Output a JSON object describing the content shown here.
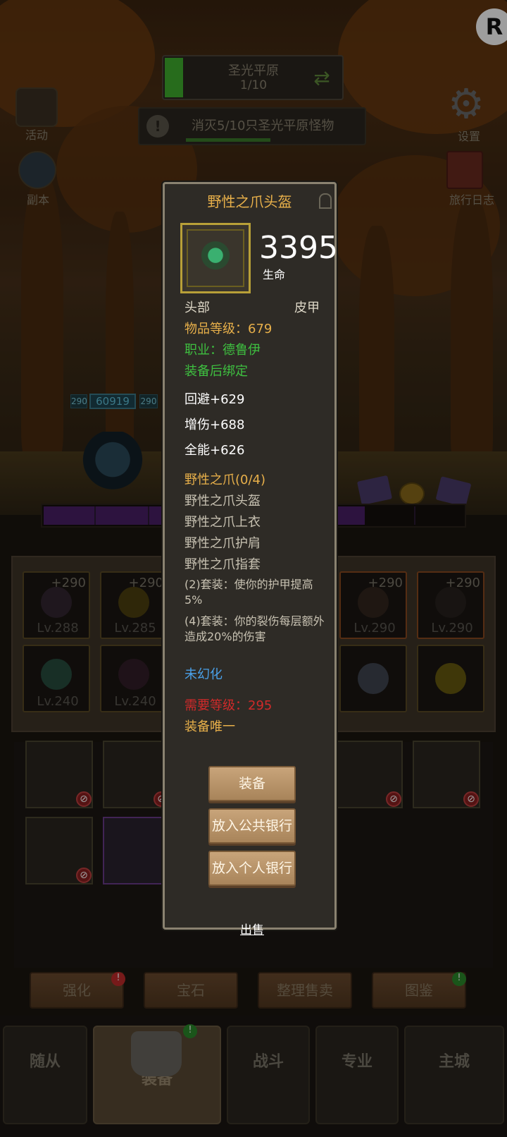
{
  "hud": {
    "stage_name": "圣光平原",
    "stage_progress": "1/10",
    "quest_text": "消灭5/10只圣光平原怪物",
    "quest_icon": "!",
    "side_left": [
      {
        "label": "活动",
        "icon": "scroll-icon"
      },
      {
        "label": "副本",
        "icon": "portal-icon"
      }
    ],
    "side_right": [
      {
        "label": "设置",
        "icon": "gear-icon"
      },
      {
        "label": "旅行日志",
        "icon": "book-icon"
      }
    ],
    "logo": "R"
  },
  "battle": {
    "level_chip_1": "290",
    "hp_value": "60919",
    "level_chip_2": "290",
    "xp_fraction": 0.76
  },
  "equipment": [
    {
      "plus": "+290",
      "level": "Lv.288"
    },
    {
      "plus": "+290",
      "level": "Lv.285"
    },
    {
      "plus": "+290",
      "level": "Lv.290"
    },
    {
      "plus": "+290",
      "level": "Lv.290"
    },
    {
      "plus": "",
      "level": "Lv.240"
    },
    {
      "plus": "",
      "level": "Lv.240"
    },
    {
      "plus": "",
      "level": ""
    },
    {
      "plus": "",
      "level": ""
    }
  ],
  "bottom_buttons": {
    "enhance": "强化",
    "gem": "宝石",
    "sort_sell": "整理售卖",
    "codex": "图鉴",
    "badge_alert": "!",
    "badge_ok": "!"
  },
  "nav": {
    "companion": "随从",
    "equipment": "装备",
    "battle": "战斗",
    "profession": "专业",
    "city": "主城",
    "badge": "!"
  },
  "tooltip": {
    "title": "野性之爪头盔",
    "stat_value": "3395",
    "stat_label": "生命",
    "slot": "头部",
    "armor_type": "皮甲",
    "item_level": "物品等级：679",
    "class_req": "职业：德鲁伊",
    "bind": "装备后绑定",
    "stats": [
      "回避+629",
      "增伤+688",
      "全能+626"
    ],
    "set_name": "野性之爪(0/4)",
    "set_items": [
      "野性之爪头盔",
      "野性之爪上衣",
      "野性之爪护肩",
      "野性之爪指套"
    ],
    "set_bonus_2": "(2)套装：使你的护甲提高5%",
    "set_bonus_4": "(4)套装：你的裂伤每层额外造成20%的伤害",
    "transmog": "未幻化",
    "req_level": "需要等级：295",
    "unique": "装备唯一",
    "btn_equip": "装备",
    "btn_public_bank": "放入公共银行",
    "btn_personal_bank": "放入个人银行",
    "sell": "出售"
  }
}
